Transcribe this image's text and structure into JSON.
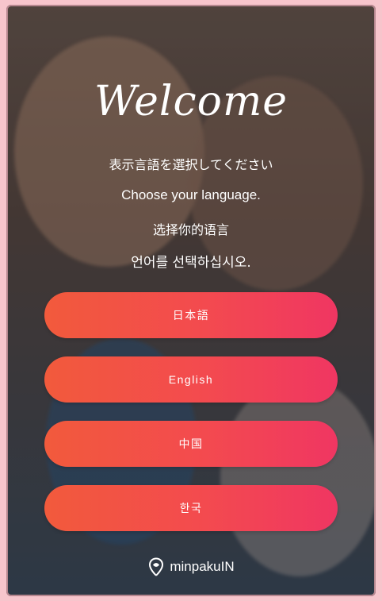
{
  "welcome_title": "Welcome",
  "instructions": {
    "ja": "表示言語を選択してください",
    "en": "Choose your language.",
    "zh": "选择你的语言",
    "ko": "언어를 선택하십시오."
  },
  "languages": [
    {
      "label": "日本語"
    },
    {
      "label": "English"
    },
    {
      "label": "中国"
    },
    {
      "label": "한국"
    }
  ],
  "brand": {
    "name": "minpakuIN",
    "icon": "map-pin-icon"
  },
  "colors": {
    "button_gradient_start": "#f25a3c",
    "button_gradient_end": "#f03662",
    "frame_border": "#f3b4bf"
  }
}
